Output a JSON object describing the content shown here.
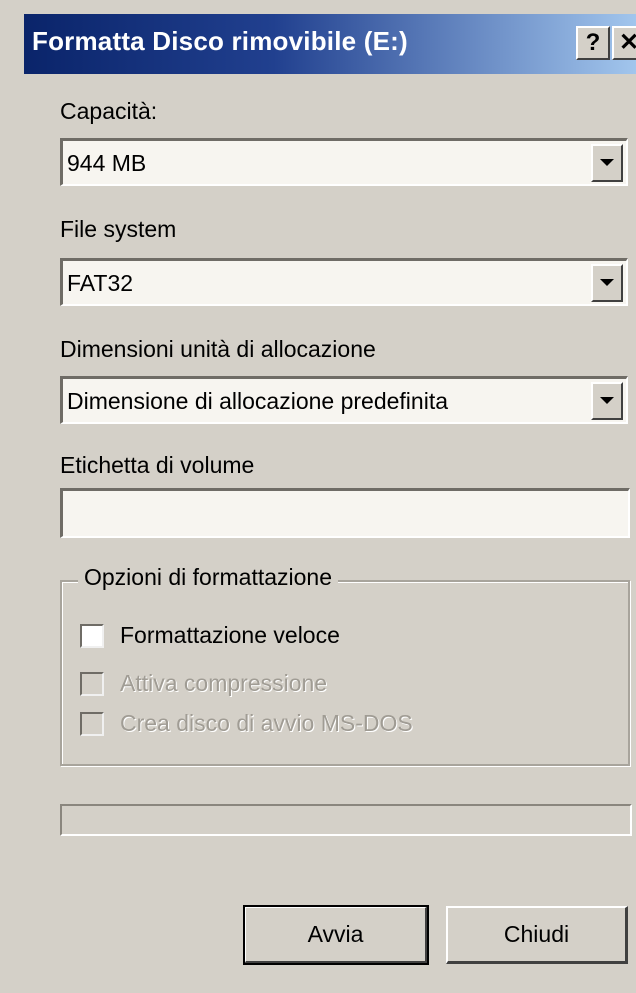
{
  "window": {
    "title": "Formatta Disco rimovibile (E:)",
    "help_label": "?",
    "close_label": "✕"
  },
  "capacity": {
    "label": "Capacità:",
    "value": "944 MB"
  },
  "file_system": {
    "label": "File system",
    "value": "FAT32"
  },
  "allocation": {
    "label": "Dimensioni unità di allocazione",
    "value": "Dimensione di allocazione predefinita"
  },
  "volume_label": {
    "label": "Etichetta di volume",
    "value": ""
  },
  "options": {
    "title": "Opzioni di formattazione",
    "items": [
      {
        "label": "Formattazione veloce",
        "checked": false,
        "enabled": true
      },
      {
        "label": "Attiva compressione",
        "checked": false,
        "enabled": false
      },
      {
        "label": "Crea disco di avvio MS-DOS",
        "checked": false,
        "enabled": false
      }
    ]
  },
  "progress": {
    "fraction": 0
  },
  "buttons": {
    "start_label": "Avvia",
    "close_label": "Chiudi"
  },
  "colors": {
    "titlebar_start": "#0a246a",
    "titlebar_end": "#a6caf0",
    "face": "#d4d0c8"
  }
}
